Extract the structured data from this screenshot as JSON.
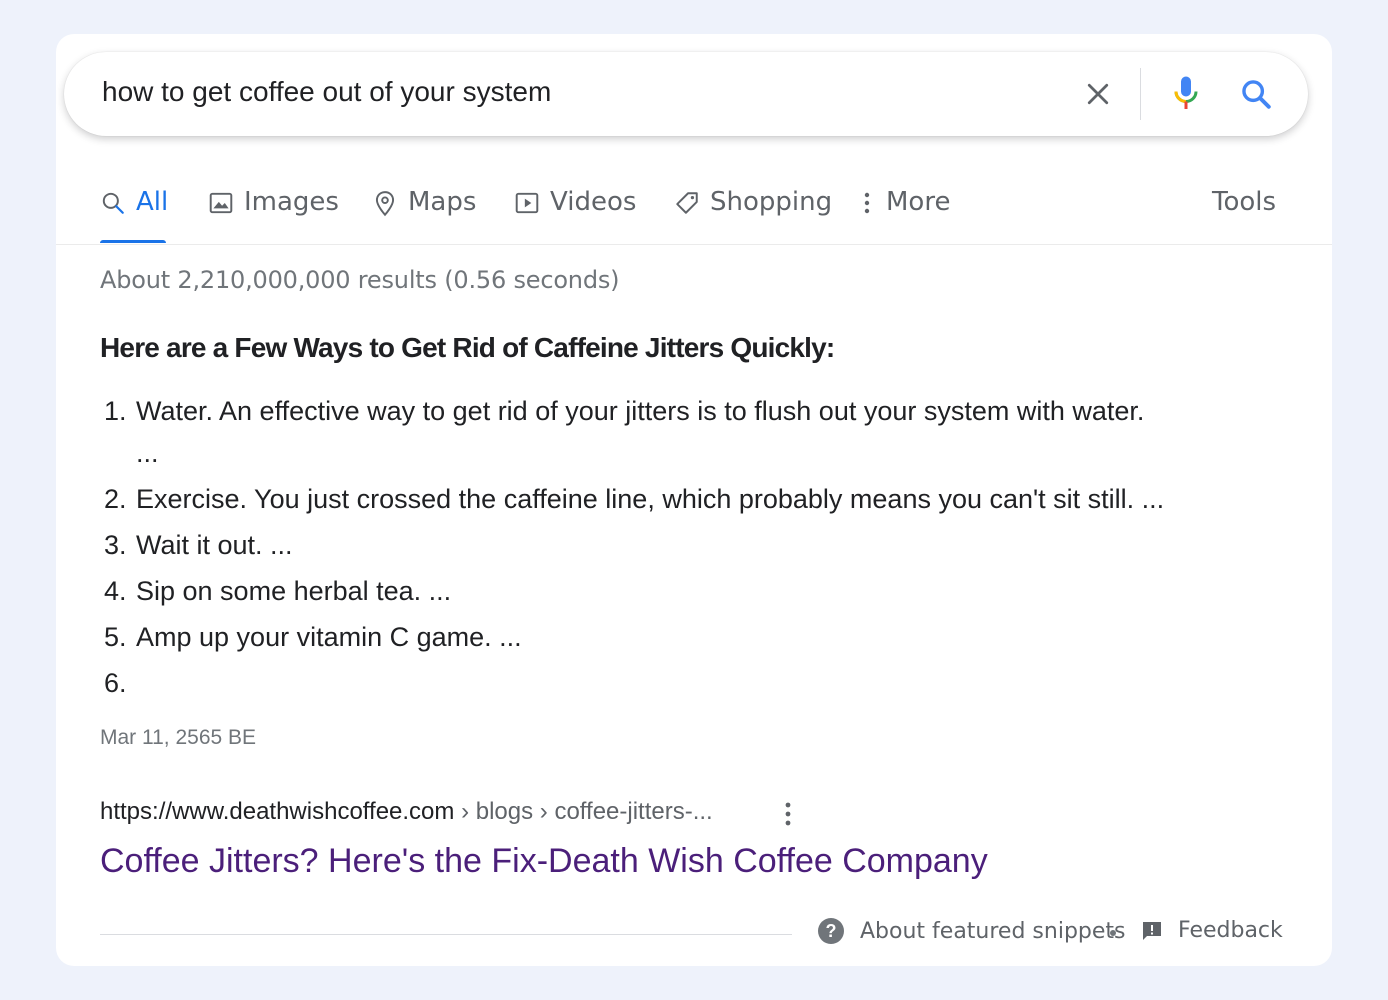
{
  "search": {
    "query": "how to get coffee out of your system",
    "clear_icon": "close-icon",
    "mic_icon": "microphone-icon",
    "search_icon": "search-icon"
  },
  "tabs": [
    {
      "label": "All",
      "icon": "search-icon",
      "active": true
    },
    {
      "label": "Images",
      "icon": "image-icon"
    },
    {
      "label": "Maps",
      "icon": "map-pin-icon"
    },
    {
      "label": "Videos",
      "icon": "play-icon"
    },
    {
      "label": "Shopping",
      "icon": "tag-icon"
    },
    {
      "label": "More",
      "icon": "more-vert-icon"
    }
  ],
  "tools_label": "Tools",
  "stats": "About 2,210,000,000 results (0.56 seconds)",
  "snippet": {
    "heading": "Here are a Few Ways to Get Rid of Caffeine Jitters Quickly:",
    "items": [
      {
        "num": "1.",
        "text": "Water. An effective way to get rid of your jitters is to flush out your system with water.",
        "continuation": "..."
      },
      {
        "num": "2.",
        "text": "Exercise. You just crossed the caffeine line, which probably means you can't sit still. ..."
      },
      {
        "num": "3.",
        "text": "Wait it out. ..."
      },
      {
        "num": "4.",
        "text": "Sip on some herbal tea. ..."
      },
      {
        "num": "5.",
        "text": "Amp up your vitamin C game. ..."
      },
      {
        "num": "6.",
        "text": ""
      }
    ],
    "date": "Mar 11, 2565 BE"
  },
  "result": {
    "url_base": "https://www.deathwishcoffee.com",
    "breadcrumb": " › blogs › coffee-jitters-...",
    "title": "Coffee Jitters? Here's the Fix-Death Wish Coffee Company"
  },
  "footer": {
    "about_label": "About featured snippets",
    "feedback_label": "Feedback"
  },
  "colors": {
    "accent": "#1a73e8",
    "visited_link": "#4b1f7a",
    "background": "#eef2fb"
  }
}
